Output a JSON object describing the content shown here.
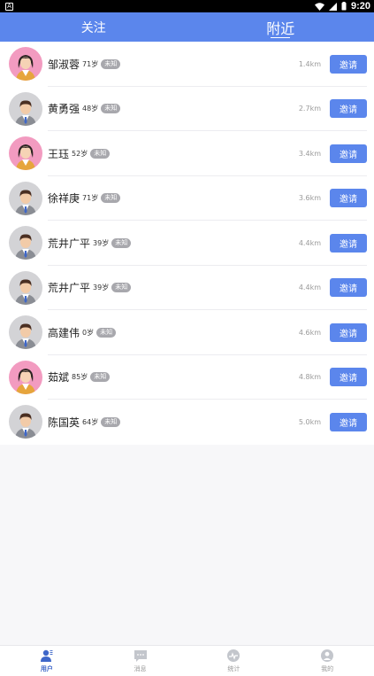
{
  "status_bar": {
    "notice_icon": "A",
    "time": "9:20"
  },
  "header": {
    "tabs": [
      {
        "label": "关注",
        "active": false
      },
      {
        "label": "附近",
        "active": true
      }
    ]
  },
  "users": [
    {
      "name": "邹淑蓉",
      "age": "71岁",
      "badge": "未知",
      "distance": "1.4km",
      "invite_label": "邀请",
      "gender": "female"
    },
    {
      "name": "黄勇强",
      "age": "48岁",
      "badge": "未知",
      "distance": "2.7km",
      "invite_label": "邀请",
      "gender": "male"
    },
    {
      "name": "王珏",
      "age": "52岁",
      "badge": "未知",
      "distance": "3.4km",
      "invite_label": "邀请",
      "gender": "female"
    },
    {
      "name": "徐祥庚",
      "age": "71岁",
      "badge": "未知",
      "distance": "3.6km",
      "invite_label": "邀请",
      "gender": "male"
    },
    {
      "name": "荒井广平",
      "age": "39岁",
      "badge": "未知",
      "distance": "4.4km",
      "invite_label": "邀请",
      "gender": "male"
    },
    {
      "name": "荒井广平",
      "age": "39岁",
      "badge": "未知",
      "distance": "4.4km",
      "invite_label": "邀请",
      "gender": "male"
    },
    {
      "name": "高建伟",
      "age": "0岁",
      "badge": "未知",
      "distance": "4.6km",
      "invite_label": "邀请",
      "gender": "male"
    },
    {
      "name": "茹斌",
      "age": "85岁",
      "badge": "未知",
      "distance": "4.8km",
      "invite_label": "邀请",
      "gender": "female"
    },
    {
      "name": "陈国英",
      "age": "64岁",
      "badge": "未知",
      "distance": "5.0km",
      "invite_label": "邀请",
      "gender": "male"
    }
  ],
  "bottom_nav": [
    {
      "label": "用户",
      "icon": "users-icon",
      "active": true
    },
    {
      "label": "消息",
      "icon": "message-icon",
      "active": false
    },
    {
      "label": "统计",
      "icon": "stats-icon",
      "active": false
    },
    {
      "label": "我的",
      "icon": "profile-icon",
      "active": false
    }
  ],
  "colors": {
    "primary": "#5b86ec",
    "badge": "#a8a8ad",
    "female_avatar_bg": "#f29bc0",
    "male_avatar_bg": "#d3d3d6"
  }
}
